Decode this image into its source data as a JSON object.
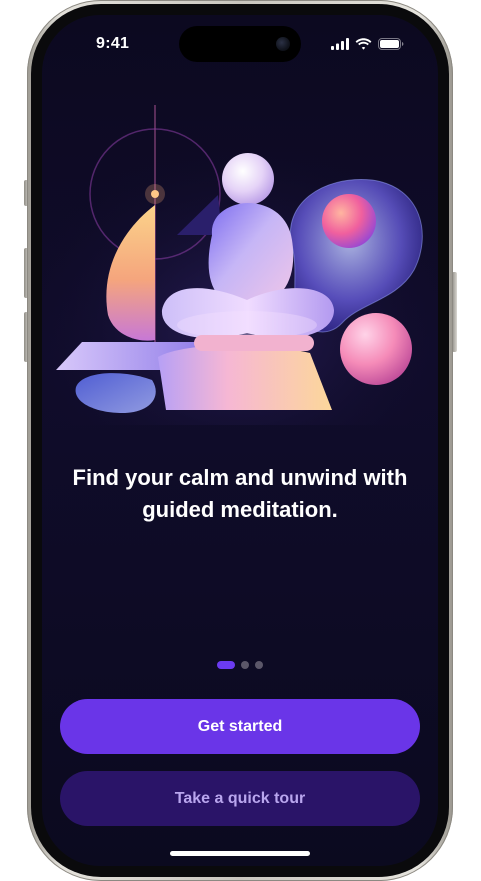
{
  "status_bar": {
    "time": "9:41",
    "icons": [
      "cellular-signal-icon",
      "wifi-icon",
      "battery-icon"
    ]
  },
  "onboarding": {
    "headline": "Find your calm and unwind with guided meditation.",
    "page_indicator": {
      "total": 3,
      "active_index": 0
    }
  },
  "actions": {
    "primary_label": "Get started",
    "secondary_label": "Take a quick tour"
  },
  "colors": {
    "background": "#0c0920",
    "primary_button": "#6a35e8",
    "secondary_button": "#2a1468",
    "secondary_text": "#b9a6ee",
    "dot_active": "#6b3bf0",
    "dot_inactive": "#5b5769"
  }
}
